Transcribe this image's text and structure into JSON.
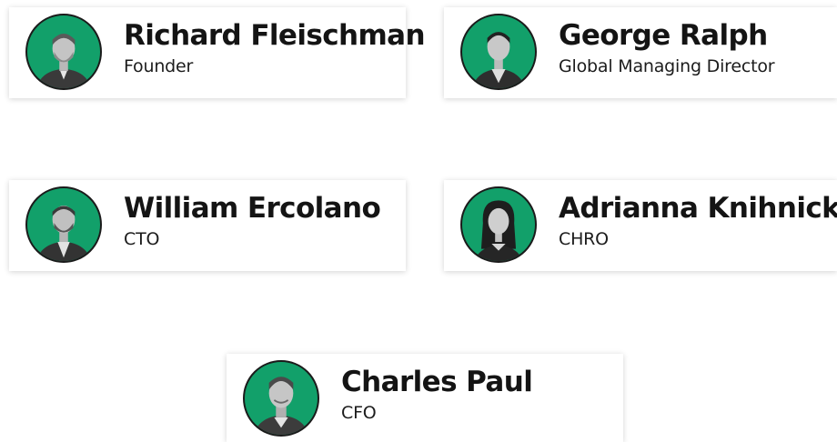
{
  "colors": {
    "avatar_background": "#12a06a",
    "name_text": "#141414"
  },
  "team": [
    {
      "name": "Richard Fleischman",
      "title": "Founder",
      "photo_icon": "person-photo-icon"
    },
    {
      "name": "George Ralph",
      "title": "Global Managing Director",
      "photo_icon": "person-photo-icon"
    },
    {
      "name": "William Ercolano",
      "title": "CTO",
      "photo_icon": "person-photo-icon"
    },
    {
      "name": "Adrianna Knihnicky",
      "title": "CHRO",
      "photo_icon": "person-photo-icon"
    },
    {
      "name": "Charles Paul",
      "title": "CFO",
      "photo_icon": "person-photo-icon"
    }
  ]
}
